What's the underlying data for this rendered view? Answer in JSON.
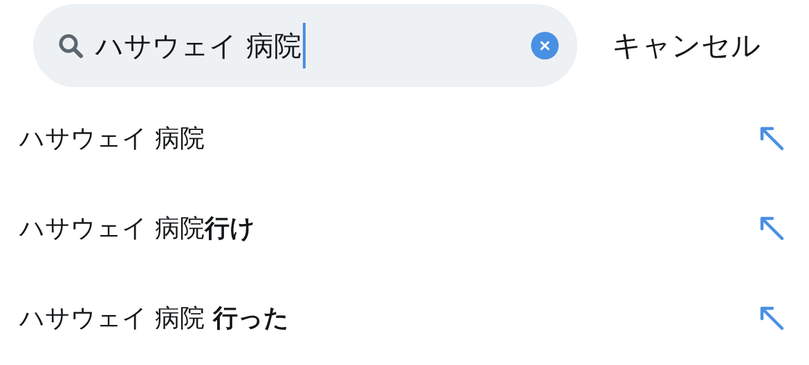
{
  "search": {
    "value": "ハサウェイ 病院",
    "cancel": "キャンセル"
  },
  "suggestions": [
    {
      "text": "ハサウェイ 病院"
    },
    {
      "text": "ハサウェイ 病院**行け**"
    },
    {
      "text": "ハサウェイ 病院 **行った**"
    }
  ]
}
